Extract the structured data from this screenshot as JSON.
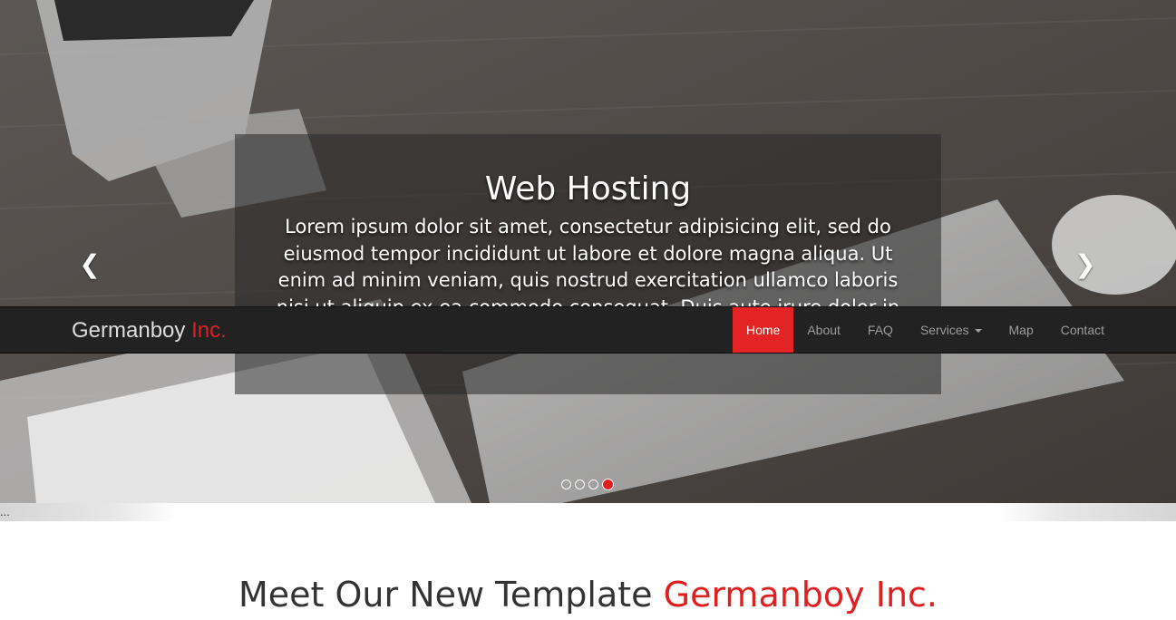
{
  "hero": {
    "caption_title": "Web Hosting",
    "caption_text": "Lorem ipsum dolor sit amet, consectetur adipisicing elit, sed do eiusmod tempor incididunt ut labore et dolore magna aliqua. Ut enim ad minim veniam, quis nostrud exercitation ullamco laboris nisi ut aliquip ex ea commodo consequat. Duis aute irure dolor in reprehenderit in voluptate",
    "prev_icon": "chevron-left-icon",
    "next_icon": "chevron-right-icon",
    "indicators": {
      "count": 4,
      "active_index": 3
    },
    "accent_color": "#e02020"
  },
  "navbar": {
    "brand_main": "Germanboy",
    "brand_accent": "Inc.",
    "items": [
      {
        "label": "Home",
        "active": true
      },
      {
        "label": "About"
      },
      {
        "label": "FAQ"
      },
      {
        "label": "Services",
        "dropdown": true
      },
      {
        "label": "Map"
      },
      {
        "label": "Contact"
      }
    ]
  },
  "strip": {
    "text": "..."
  },
  "section": {
    "title_main": "Meet Our New Template",
    "title_accent": "Germanboy Inc."
  }
}
